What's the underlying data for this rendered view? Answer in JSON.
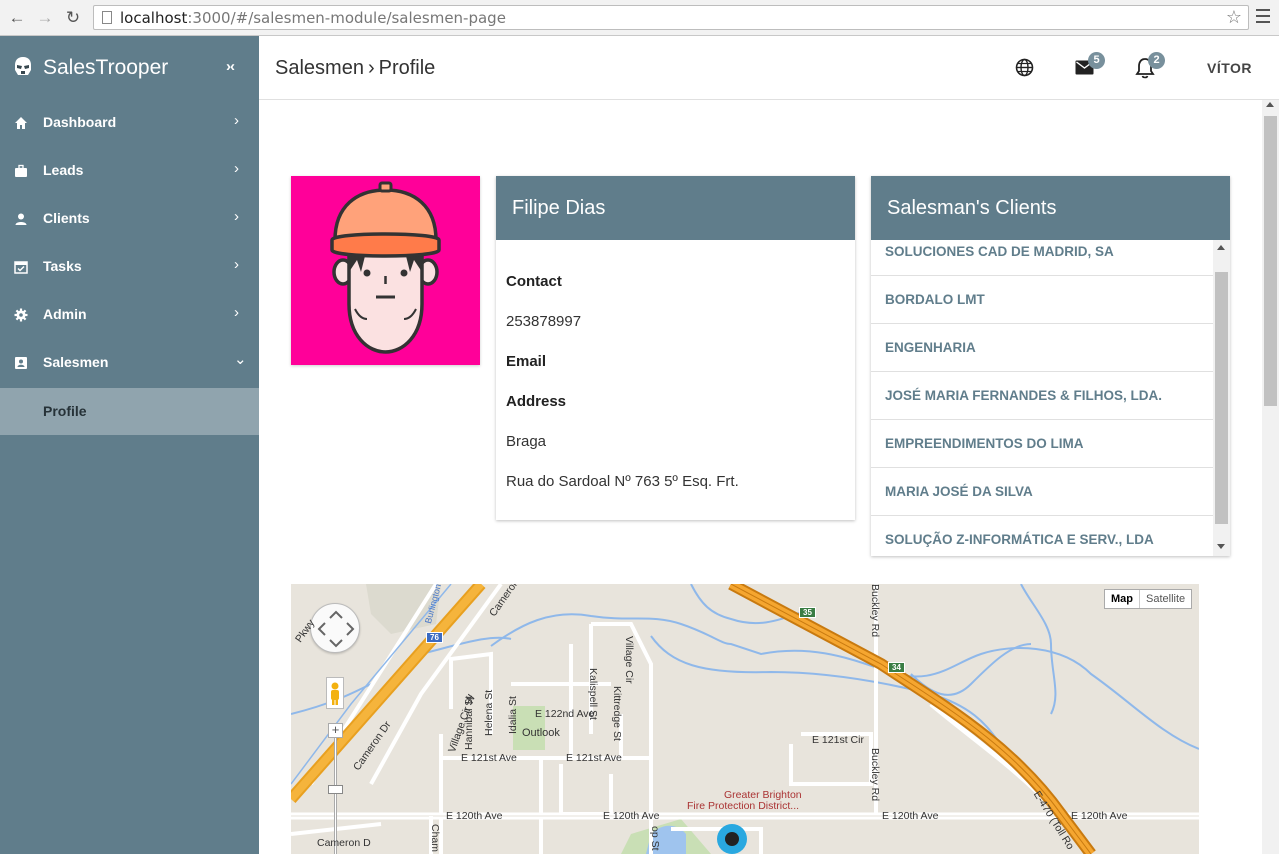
{
  "browser": {
    "url_host": "localhost",
    "url_rest": ":3000/#/salesmen-module/salesmen-page"
  },
  "sidebar": {
    "brand": "SalesTrooper",
    "collapse_label": "›‹",
    "items": [
      {
        "label": "Dashboard",
        "icon": "home-icon",
        "chevron": "›"
      },
      {
        "label": "Leads",
        "icon": "briefcase-icon",
        "chevron": "›"
      },
      {
        "label": "Clients",
        "icon": "person-icon",
        "chevron": "›"
      },
      {
        "label": "Tasks",
        "icon": "calendar-check-icon",
        "chevron": "›"
      },
      {
        "label": "Admin",
        "icon": "gear-icon",
        "chevron": "›"
      },
      {
        "label": "Salesmen",
        "icon": "contact-card-icon",
        "chevron": "⌄"
      }
    ],
    "sub_items": [
      {
        "label": "Profile"
      }
    ]
  },
  "header": {
    "breadcrumb_parent": "Salesmen",
    "breadcrumb_sep": "›",
    "breadcrumb_current": "Profile",
    "mail_count": "5",
    "notification_count": "2",
    "user": "VÍTOR"
  },
  "profile": {
    "name": "Filipe Dias",
    "contact_label": "Contact",
    "contact_value": "253878997",
    "email_label": "Email",
    "address_label": "Address",
    "city": "Braga",
    "street": "Rua do Sardoal Nº 763 5º Esq. Frt."
  },
  "clients": {
    "title": "Salesman's Clients",
    "items": [
      "SOLUCIONES CAD DE MADRID, SA",
      "BORDALO LMT",
      "ENGENHARIA",
      "JOSÉ MARIA FERNANDES & FILHOS, LDA.",
      "EMPREENDIMENTOS DO LIMA",
      "MARIA JOSÉ DA SILVA",
      "SOLUÇÃO Z-INFORMÁTICA E SERV., LDA"
    ]
  },
  "map": {
    "type_map": "Map",
    "type_satellite": "Satellite",
    "labels": {
      "pkwy": "Pkwy",
      "burlington": "Burlington",
      "cameron_top": "Cameron",
      "cameron_dr": "Cameron Dr",
      "cameron_bottom": "Cameron D",
      "village_cir_w": "Village Cir W",
      "hannibal": "Hannibal St",
      "helena": "Helena St",
      "idalia": "Idalia St",
      "kalispell": "Kalispell St",
      "kittredge": "Kittredge St",
      "village_cir": "Village Cir",
      "e122": "E 122nd Ave",
      "outlook": "Outlook",
      "e121_a": "E 121st Ave",
      "e121_b": "E 121st Ave",
      "e121cir": "E 121st Cir",
      "buckley_top": "Buckley Rd",
      "buckley": "Buckley Rd",
      "brighton1": "Greater Brighton",
      "brighton2": "Fire Protection District...",
      "e120_a": "E 120th Ave",
      "e120_b": "E 120th Ave",
      "e120_c": "E 120th Ave",
      "e120_d": "E 120th Ave",
      "e470": "E-470 (Toll Ro",
      "cham": "Cham",
      "opp": "op St",
      "hw76": "76",
      "hw35": "35",
      "hw34": "34"
    }
  }
}
